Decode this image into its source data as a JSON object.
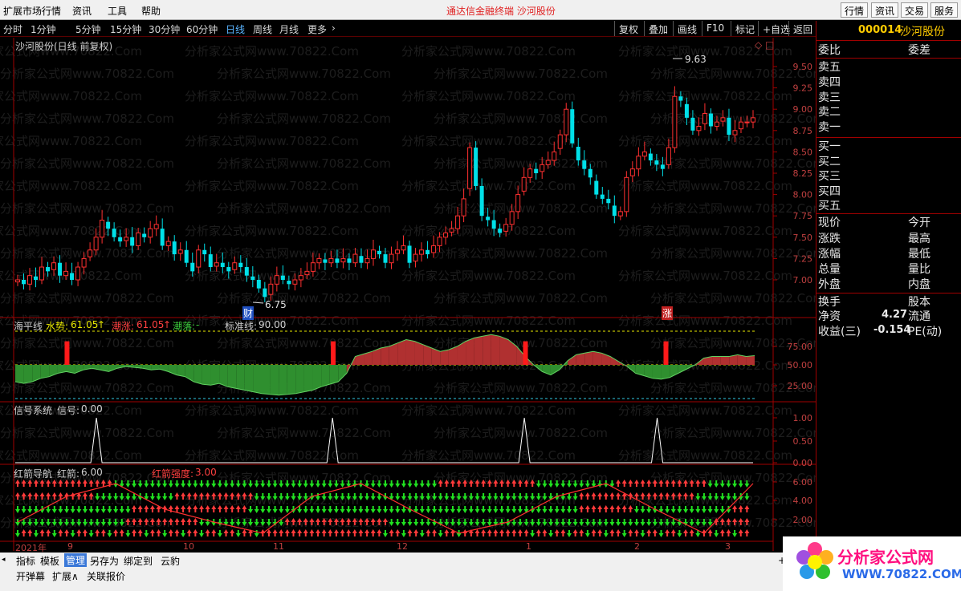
{
  "menu": {
    "items": [
      "扩展市场行情",
      "资讯",
      "工具",
      "帮助"
    ],
    "title": "通达信金融终端  沙河股份"
  },
  "top_buttons": [
    "行情",
    "资讯",
    "交易",
    "服务"
  ],
  "timeframes": [
    "分时",
    "1分钟",
    "5分钟",
    "15分钟",
    "30分钟",
    "60分钟",
    "日线",
    "周线",
    "月线",
    "更多"
  ],
  "active_timeframe": "日线",
  "chart_tools": [
    "复权",
    "叠加",
    "画线",
    "F10",
    "标记",
    "+自选",
    "返回"
  ],
  "stock": {
    "code": "000014",
    "name": "沙河股份"
  },
  "main_chart": {
    "title": "沙河股份(日线 前复权)",
    "high_label": "9.63",
    "low_label": "6.75",
    "markers": [
      "财",
      "涨"
    ],
    "y_ticks": [
      "9.50",
      "9.25",
      "9.00",
      "8.75",
      "8.50",
      "8.25",
      "8.00",
      "7.75",
      "7.50",
      "7.25",
      "7.00"
    ]
  },
  "ind1": {
    "name": "海平线",
    "water_label": "水势:",
    "water_value": "61.05",
    "rise_label": "潮涨:",
    "rise_value": "61.05",
    "fall_label": "潮落:",
    "fall_value": "-",
    "std_label": "标准线:",
    "std_value": "90.00",
    "y_ticks": [
      "75.00",
      "50.00",
      "25.00"
    ]
  },
  "ind2": {
    "name": "信号系统",
    "signal_label": "信号:",
    "signal_value": "0.00",
    "y_ticks": [
      "1.00",
      "0.50",
      "0.00"
    ]
  },
  "ind3": {
    "name": "红箭导航",
    "arrow_label": "红箭:",
    "arrow_value": "6.00",
    "strength_label": "红箭强度:",
    "strength_value": "3.00",
    "y_ticks": [
      "6.00",
      "4.00",
      "2.00"
    ]
  },
  "x_axis": [
    "2021年",
    "9",
    "10",
    "11",
    "12",
    "1",
    "2",
    "3"
  ],
  "panel": {
    "rows": [
      {
        "label": "委比",
        "right": "委差"
      },
      {
        "label": "卖五",
        "right": ""
      },
      {
        "label": "卖四",
        "right": ""
      },
      {
        "label": "卖三",
        "right": ""
      },
      {
        "label": "卖二",
        "right": ""
      },
      {
        "label": "卖一",
        "right": ""
      },
      {
        "label": "买一",
        "right": ""
      },
      {
        "label": "买二",
        "right": ""
      },
      {
        "label": "买三",
        "right": ""
      },
      {
        "label": "买四",
        "right": ""
      },
      {
        "label": "买五",
        "right": ""
      },
      {
        "label": "现价",
        "right": "今开"
      },
      {
        "label": "涨跌",
        "right": "最高"
      },
      {
        "label": "涨幅",
        "right": "最低"
      },
      {
        "label": "总量",
        "right": "量比"
      },
      {
        "label": "外盘",
        "right": "内盘"
      },
      {
        "label": "换手",
        "right": "股本"
      },
      {
        "label": "净资",
        "value": "4.27",
        "right": "流通"
      },
      {
        "label": "收益(三)",
        "value": "-0.154",
        "right": "PE(动)"
      }
    ]
  },
  "bottom_tabs": [
    "指标",
    "模板",
    "管理",
    "另存为",
    "绑定到",
    "云豹"
  ],
  "bottom_active": "管理",
  "bottom_row2": [
    "开弹幕",
    "扩展∧",
    "关联报价"
  ],
  "watermark": "分析家公式网www.70822.Com",
  "logo": {
    "title": "分析家公式网",
    "url": "WWW.70822.COM"
  },
  "colors": {
    "up": "#ff3030",
    "down": "#00e0e8",
    "grid": "#a00000",
    "green": "#3cba3c",
    "arrow_green": "#20e020",
    "arrow_red": "#ff3a3a"
  },
  "chart_data": [
    {
      "type": "candlestick",
      "title": "沙河股份(日线 前复权)",
      "x_range": [
        "2021-08",
        "2022-03"
      ],
      "ylim": [
        6.7,
        9.7
      ],
      "close_series": [
        7.0,
        6.95,
        7.05,
        7.0,
        7.15,
        7.1,
        7.2,
        7.05,
        7.1,
        7.0,
        7.15,
        7.25,
        7.35,
        7.5,
        7.7,
        7.6,
        7.5,
        7.45,
        7.5,
        7.4,
        7.55,
        7.5,
        7.6,
        7.65,
        7.4,
        7.45,
        7.3,
        7.35,
        7.2,
        7.1,
        7.35,
        7.3,
        7.15,
        7.2,
        7.15,
        7.1,
        7.2,
        7.15,
        7.05,
        7.0,
        6.9,
        6.8,
        6.95,
        7.05,
        7.0,
        6.95,
        7.0,
        7.05,
        7.1,
        7.2,
        7.25,
        7.2,
        7.25,
        7.2,
        7.25,
        7.2,
        7.3,
        7.2,
        7.25,
        7.35,
        7.3,
        7.2,
        7.3,
        7.35,
        7.4,
        7.2,
        7.3,
        7.35,
        7.3,
        7.4,
        7.5,
        7.55,
        7.6,
        7.75,
        7.95,
        8.55,
        8.1,
        7.75,
        7.7,
        7.6,
        7.55,
        7.65,
        7.8,
        8.0,
        8.2,
        8.3,
        8.25,
        8.35,
        8.4,
        8.5,
        8.7,
        9.0,
        8.6,
        8.4,
        8.3,
        8.2,
        8.0,
        7.95,
        7.9,
        7.75,
        7.8,
        8.2,
        8.3,
        8.45,
        8.5,
        8.4,
        8.35,
        8.3,
        8.55,
        9.15,
        9.1,
        8.9,
        8.75,
        8.8,
        8.95,
        8.8,
        8.85,
        8.9,
        8.7,
        8.75,
        8.85,
        8.85,
        8.9
      ],
      "high": 9.63,
      "low": 6.75
    },
    {
      "type": "area",
      "title": "海平线",
      "ylim": [
        0,
        100
      ],
      "reference_lines": [
        90,
        50,
        10
      ],
      "values": [
        30,
        28,
        30,
        34,
        36,
        40,
        42,
        40,
        44,
        46,
        44,
        42,
        46,
        48,
        47,
        46,
        44,
        45,
        42,
        38,
        36,
        30,
        27,
        26,
        28,
        24,
        22,
        20,
        18,
        16,
        15,
        14,
        15,
        16,
        18,
        20,
        24,
        27,
        30,
        40,
        60,
        63,
        66,
        70,
        72,
        76,
        80,
        78,
        74,
        70,
        66,
        68,
        72,
        78,
        82,
        84,
        86,
        84,
        80,
        72,
        60,
        50,
        42,
        38,
        44,
        55,
        62,
        64,
        66,
        64,
        60,
        54,
        48,
        40,
        37,
        34,
        33,
        35,
        40,
        45,
        50,
        58,
        60,
        60,
        60,
        62,
        60,
        61
      ]
    },
    {
      "type": "line",
      "title": "信号系统",
      "ylim": [
        0,
        1
      ],
      "signal_positions": [
        0.11,
        0.43,
        0.69,
        0.87
      ]
    },
    {
      "type": "arrows",
      "title": "红箭导航",
      "ylim": [
        0,
        7
      ],
      "values": [
        6,
        3
      ]
    }
  ]
}
